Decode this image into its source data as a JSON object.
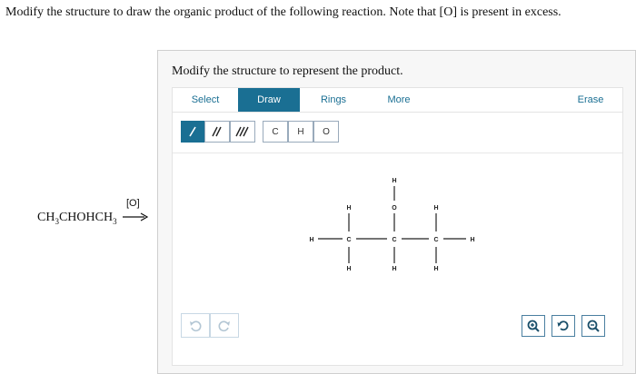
{
  "question": "Modify the structure to draw the organic product of the following reaction. Note that [O] is present in excess.",
  "reaction": {
    "reactant_parts": [
      "CH",
      "3",
      "CHOHCH",
      "3"
    ],
    "reagent": "[O]"
  },
  "instruction": "Modify the structure to represent the product.",
  "tabs": {
    "select": "Select",
    "draw": "Draw",
    "rings": "Rings",
    "more": "More",
    "erase": "Erase"
  },
  "bond_tools": [
    "single-bond",
    "double-bond",
    "triple-bond"
  ],
  "atom_tools": {
    "c": "C",
    "h": "H",
    "o": "O"
  },
  "molecule": {
    "atoms": {
      "h_top": "H",
      "o": "O",
      "h_left_up": "H",
      "h_left": "H",
      "c_left": "C",
      "h_left_down": "H",
      "c_mid": "C",
      "h_mid_down": "H",
      "h_right_up": "H",
      "c_right": "C",
      "h_right": "H",
      "h_right_down": "H"
    }
  },
  "colors": {
    "accent": "#1a6f93"
  },
  "icons": [
    "undo-icon",
    "redo-icon",
    "zoom-in-icon",
    "reset-zoom-icon",
    "zoom-out-icon"
  ]
}
